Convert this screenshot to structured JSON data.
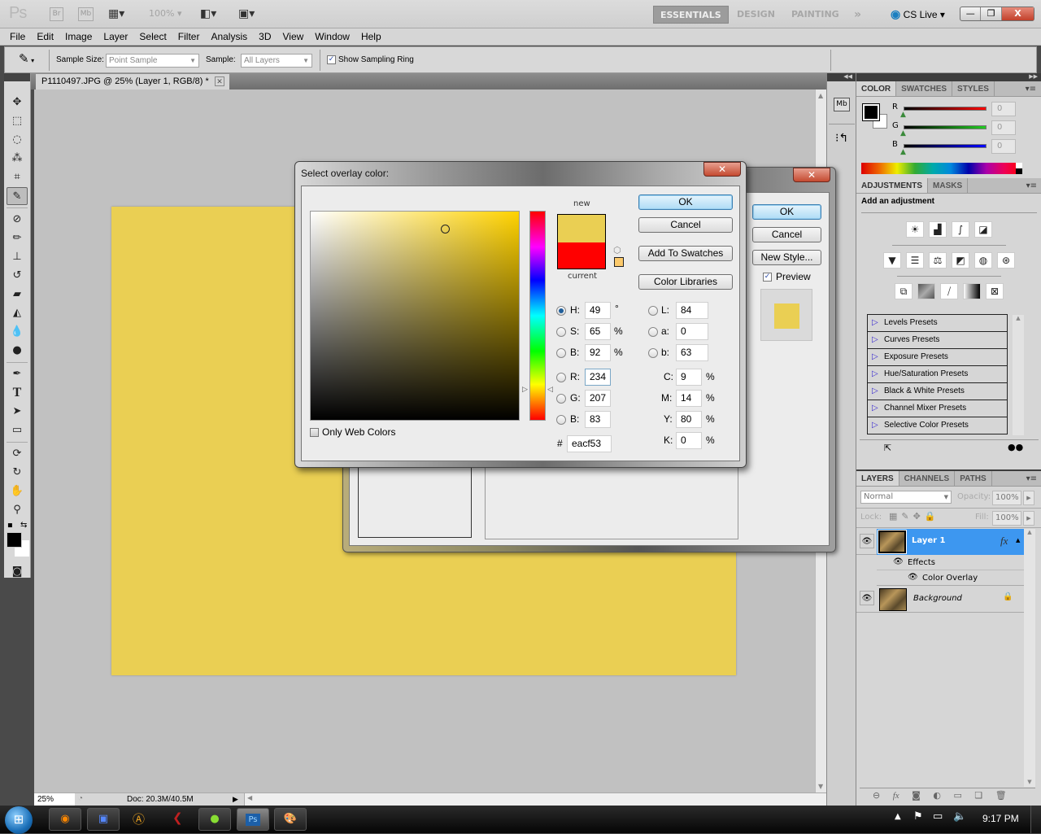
{
  "app": {
    "logo": "Ps",
    "bridge_btn": "Br",
    "minibridge_btn": "Mb",
    "zoom_level": "100%",
    "workspaces": [
      "ESSENTIALS",
      "DESIGN",
      "PAINTING"
    ],
    "workspace_more": "»",
    "cs_live": "CS Live",
    "window_controls": {
      "minimize": "—",
      "restore": "❐",
      "close": "X"
    }
  },
  "menubar": {
    "items": [
      "File",
      "Edit",
      "Image",
      "Layer",
      "Select",
      "Filter",
      "Analysis",
      "3D",
      "View",
      "Window",
      "Help"
    ]
  },
  "options": {
    "sample_size_label": "Sample Size:",
    "sample_size_value": "Point Sample",
    "sample_label": "Sample:",
    "sample_value": "All Layers",
    "show_ring_label": "Show Sampling Ring",
    "show_ring_checked": true
  },
  "document": {
    "tab_title": "P1110497.JPG @ 25% (Layer 1, RGB/8) *",
    "overlay_color": "#eacf53",
    "status_zoom": "25%",
    "status_doc": "Doc: 20.3M/40.5M"
  },
  "toolbox": {
    "tools": [
      "move-tool",
      "marquee-tool",
      "lasso-tool",
      "quick-selection-tool",
      "crop-tool",
      "eyedropper-tool",
      "spot-healing-tool",
      "brush-tool",
      "clone-stamp-tool",
      "history-brush-tool",
      "eraser-tool",
      "paint-bucket-tool",
      "blur-tool",
      "dodge-tool",
      "pen-tool",
      "type-tool",
      "path-selection-tool",
      "rectangle-tool",
      "3d-rotate-tool",
      "3d-orbit-tool",
      "hand-tool",
      "zoom-tool"
    ],
    "selected_tool": "eyedropper-tool",
    "foreground": "#000000",
    "background": "#ffffff"
  },
  "color_panel": {
    "tabs": [
      "COLOR",
      "SWATCHES",
      "STYLES"
    ],
    "r_label": "R",
    "r_value": "0",
    "g_label": "G",
    "g_value": "0",
    "b_label": "B",
    "b_value": "0"
  },
  "adjustments_panel": {
    "tabs": [
      "ADJUSTMENTS",
      "MASKS"
    ],
    "subtitle": "Add an adjustment",
    "presets": [
      "Levels Presets",
      "Curves Presets",
      "Exposure Presets",
      "Hue/Saturation Presets",
      "Black & White Presets",
      "Channel Mixer Presets",
      "Selective Color Presets"
    ]
  },
  "layers_panel": {
    "tabs": [
      "LAYERS",
      "CHANNELS",
      "PATHS"
    ],
    "blend_mode": "Normal",
    "opacity_label": "Opacity:",
    "opacity_value": "100%",
    "lock_label": "Lock:",
    "fill_label": "Fill:",
    "fill_value": "100%",
    "layers": [
      {
        "name": "Layer 1",
        "selected": true,
        "fx": "fx"
      },
      {
        "name": "Effects"
      },
      {
        "name": "Color Overlay"
      },
      {
        "name": "Background",
        "locked": true
      }
    ]
  },
  "layer_style_dialog": {
    "ok": "OK",
    "cancel": "Cancel",
    "new_style": "New Style...",
    "preview_label": "Preview",
    "preview_checked": true
  },
  "color_picker": {
    "title": "Select overlay color:",
    "new_label": "new",
    "current_label": "current",
    "new_color": "#eacf53",
    "current_color": "#ff0000",
    "ok": "OK",
    "cancel": "Cancel",
    "add_to_swatches": "Add To Swatches",
    "color_libraries": "Color Libraries",
    "only_web_colors": "Only Web Colors",
    "only_web_checked": false,
    "fields": {
      "H": "49",
      "S": "65",
      "Bv": "92",
      "R": "234",
      "G": "207",
      "B": "83",
      "L": "84",
      "a": "0",
      "b": "63",
      "C": "9",
      "M": "14",
      "Y": "80",
      "K": "0",
      "hex": "eacf53"
    },
    "units": {
      "deg": "°",
      "pct": "%"
    },
    "selected_mode": "H"
  },
  "taskbar": {
    "time": "9:17 PM",
    "apps": [
      "firefox",
      "save",
      "avast",
      "app-red",
      "app-green",
      "photoshop",
      "paint"
    ],
    "active_app": "photoshop",
    "photoshop_label": "Ps"
  }
}
